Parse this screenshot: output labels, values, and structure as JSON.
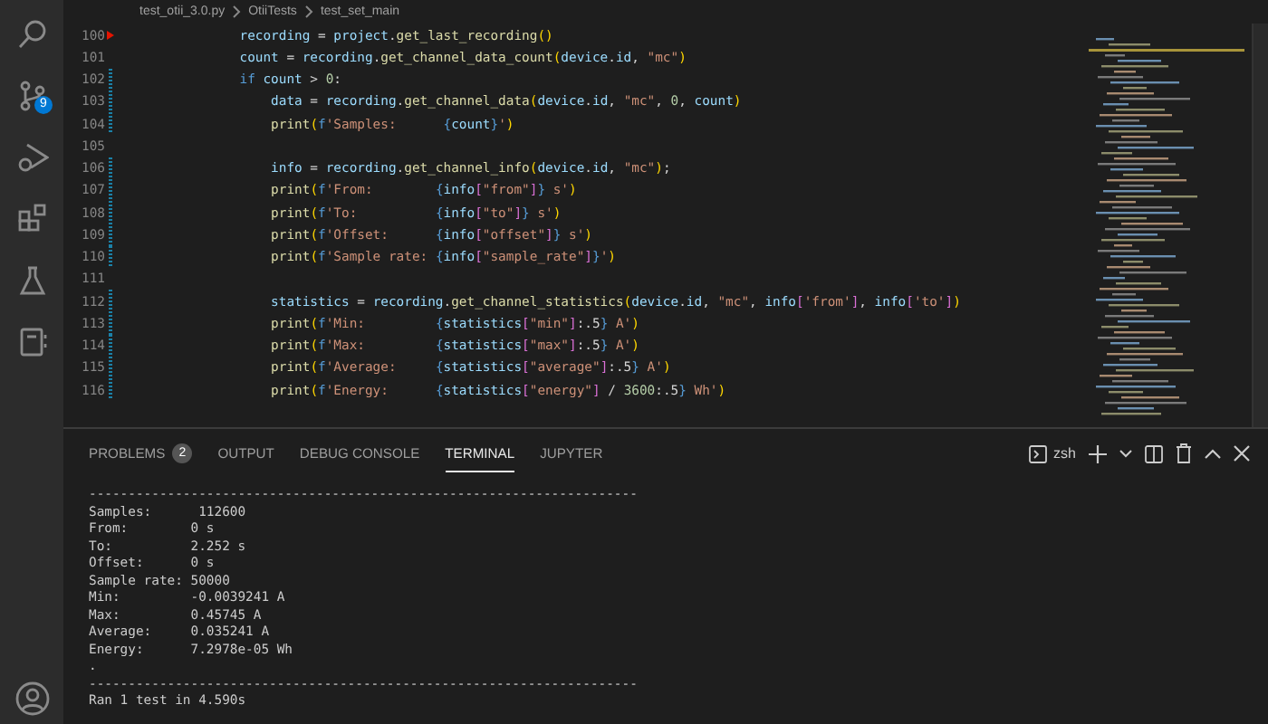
{
  "activity_bar": {
    "items": [
      {
        "kind": "search"
      },
      {
        "kind": "source-control",
        "badge": "9"
      },
      {
        "kind": "run"
      },
      {
        "kind": "extensions"
      },
      {
        "kind": "testing"
      },
      {
        "kind": "notebook"
      }
    ],
    "bottom": [
      {
        "kind": "account"
      }
    ]
  },
  "breadcrumb": [
    "test_otii_3.0.py",
    "OtiiTests",
    "test_set_main"
  ],
  "editor": {
    "lines": [
      {
        "number": "100",
        "breakpoint": true,
        "modified": false,
        "tokens": [
          {
            "kind": "var",
            "text": "                recording"
          },
          {
            "kind": "punc",
            "text": " = "
          },
          {
            "kind": "var",
            "text": "project"
          },
          {
            "kind": "punc",
            "text": "."
          },
          {
            "kind": "fn",
            "text": "get_last_recording"
          },
          {
            "kind": "brace",
            "text": "()"
          }
        ]
      },
      {
        "number": "101",
        "breakpoint": false,
        "modified": false,
        "tokens": [
          {
            "kind": "var",
            "text": "                count"
          },
          {
            "kind": "punc",
            "text": " = "
          },
          {
            "kind": "var",
            "text": "recording"
          },
          {
            "kind": "punc",
            "text": "."
          },
          {
            "kind": "fn",
            "text": "get_channel_data_count"
          },
          {
            "kind": "brace",
            "text": "("
          },
          {
            "kind": "var",
            "text": "device"
          },
          {
            "kind": "punc",
            "text": "."
          },
          {
            "kind": "var",
            "text": "id"
          },
          {
            "kind": "punc",
            "text": ", "
          },
          {
            "kind": "str",
            "text": "\"mc\""
          },
          {
            "kind": "brace",
            "text": ")"
          }
        ]
      },
      {
        "number": "102",
        "breakpoint": false,
        "modified": true,
        "tokens": [
          {
            "kind": "kw",
            "text": "                if"
          },
          {
            "kind": "var",
            "text": " count"
          },
          {
            "kind": "punc",
            "text": " > "
          },
          {
            "kind": "num",
            "text": "0"
          },
          {
            "kind": "punc",
            "text": ":"
          }
        ]
      },
      {
        "number": "103",
        "breakpoint": false,
        "modified": true,
        "tokens": [
          {
            "kind": "var",
            "text": "                    data"
          },
          {
            "kind": "punc",
            "text": " = "
          },
          {
            "kind": "var",
            "text": "recording"
          },
          {
            "kind": "punc",
            "text": "."
          },
          {
            "kind": "fn",
            "text": "get_channel_data"
          },
          {
            "kind": "brace",
            "text": "("
          },
          {
            "kind": "var",
            "text": "device"
          },
          {
            "kind": "punc",
            "text": "."
          },
          {
            "kind": "var",
            "text": "id"
          },
          {
            "kind": "punc",
            "text": ", "
          },
          {
            "kind": "str",
            "text": "\"mc\""
          },
          {
            "kind": "punc",
            "text": ", "
          },
          {
            "kind": "num",
            "text": "0"
          },
          {
            "kind": "punc",
            "text": ", "
          },
          {
            "kind": "var",
            "text": "count"
          },
          {
            "kind": "brace",
            "text": ")"
          }
        ]
      },
      {
        "number": "104",
        "breakpoint": false,
        "modified": true,
        "tokens": [
          {
            "kind": "fn",
            "text": "                    print"
          },
          {
            "kind": "brace",
            "text": "("
          },
          {
            "kind": "kw",
            "text": "f"
          },
          {
            "kind": "str",
            "text": "'Samples:      "
          },
          {
            "kind": "kw",
            "text": "{"
          },
          {
            "kind": "var",
            "text": "count"
          },
          {
            "kind": "kw",
            "text": "}"
          },
          {
            "kind": "str",
            "text": "'"
          },
          {
            "kind": "brace",
            "text": ")"
          }
        ]
      },
      {
        "number": "105",
        "breakpoint": false,
        "modified": false
      },
      {
        "number": "106",
        "breakpoint": false,
        "modified": true,
        "tokens": [
          {
            "kind": "var",
            "text": "                    info"
          },
          {
            "kind": "punc",
            "text": " = "
          },
          {
            "kind": "var",
            "text": "recording"
          },
          {
            "kind": "punc",
            "text": "."
          },
          {
            "kind": "fn",
            "text": "get_channel_info"
          },
          {
            "kind": "brace",
            "text": "("
          },
          {
            "kind": "var",
            "text": "device"
          },
          {
            "kind": "punc",
            "text": "."
          },
          {
            "kind": "var",
            "text": "id"
          },
          {
            "kind": "punc",
            "text": ", "
          },
          {
            "kind": "str",
            "text": "\"mc\""
          },
          {
            "kind": "brace",
            "text": ")"
          },
          {
            "kind": "punc",
            "text": ";"
          }
        ]
      },
      {
        "number": "107",
        "breakpoint": false,
        "modified": true,
        "tokens": [
          {
            "kind": "fn",
            "text": "                    print"
          },
          {
            "kind": "brace",
            "text": "("
          },
          {
            "kind": "kw",
            "text": "f"
          },
          {
            "kind": "str",
            "text": "'From:        "
          },
          {
            "kind": "kw",
            "text": "{"
          },
          {
            "kind": "var",
            "text": "info"
          },
          {
            "kind": "brace2",
            "text": "["
          },
          {
            "kind": "str",
            "text": "\"from\""
          },
          {
            "kind": "brace2",
            "text": "]"
          },
          {
            "kind": "kw",
            "text": "}"
          },
          {
            "kind": "str",
            "text": " s'"
          },
          {
            "kind": "brace",
            "text": ")"
          }
        ]
      },
      {
        "number": "108",
        "breakpoint": false,
        "modified": true,
        "tokens": [
          {
            "kind": "fn",
            "text": "                    print"
          },
          {
            "kind": "brace",
            "text": "("
          },
          {
            "kind": "kw",
            "text": "f"
          },
          {
            "kind": "str",
            "text": "'To:          "
          },
          {
            "kind": "kw",
            "text": "{"
          },
          {
            "kind": "var",
            "text": "info"
          },
          {
            "kind": "brace2",
            "text": "["
          },
          {
            "kind": "str",
            "text": "\"to\""
          },
          {
            "kind": "brace2",
            "text": "]"
          },
          {
            "kind": "kw",
            "text": "}"
          },
          {
            "kind": "str",
            "text": " s'"
          },
          {
            "kind": "brace",
            "text": ")"
          }
        ]
      },
      {
        "number": "109",
        "breakpoint": false,
        "modified": true,
        "tokens": [
          {
            "kind": "fn",
            "text": "                    print"
          },
          {
            "kind": "brace",
            "text": "("
          },
          {
            "kind": "kw",
            "text": "f"
          },
          {
            "kind": "str",
            "text": "'Offset:      "
          },
          {
            "kind": "kw",
            "text": "{"
          },
          {
            "kind": "var",
            "text": "info"
          },
          {
            "kind": "brace2",
            "text": "["
          },
          {
            "kind": "str",
            "text": "\"offset\""
          },
          {
            "kind": "brace2",
            "text": "]"
          },
          {
            "kind": "kw",
            "text": "}"
          },
          {
            "kind": "str",
            "text": " s'"
          },
          {
            "kind": "brace",
            "text": ")"
          }
        ]
      },
      {
        "number": "110",
        "breakpoint": false,
        "modified": true,
        "tokens": [
          {
            "kind": "fn",
            "text": "                    print"
          },
          {
            "kind": "brace",
            "text": "("
          },
          {
            "kind": "kw",
            "text": "f"
          },
          {
            "kind": "str",
            "text": "'Sample rate: "
          },
          {
            "kind": "kw",
            "text": "{"
          },
          {
            "kind": "var",
            "text": "info"
          },
          {
            "kind": "brace2",
            "text": "["
          },
          {
            "kind": "str",
            "text": "\"sample_rate\""
          },
          {
            "kind": "brace2",
            "text": "]"
          },
          {
            "kind": "kw",
            "text": "}"
          },
          {
            "kind": "str",
            "text": "'"
          },
          {
            "kind": "brace",
            "text": ")"
          }
        ]
      },
      {
        "number": "111",
        "breakpoint": false,
        "modified": false
      },
      {
        "number": "112",
        "breakpoint": false,
        "modified": true,
        "tokens": [
          {
            "kind": "var",
            "text": "                    statistics"
          },
          {
            "kind": "punc",
            "text": " = "
          },
          {
            "kind": "var",
            "text": "recording"
          },
          {
            "kind": "punc",
            "text": "."
          },
          {
            "kind": "fn",
            "text": "get_channel_statistics"
          },
          {
            "kind": "brace",
            "text": "("
          },
          {
            "kind": "var",
            "text": "device"
          },
          {
            "kind": "punc",
            "text": "."
          },
          {
            "kind": "var",
            "text": "id"
          },
          {
            "kind": "punc",
            "text": ", "
          },
          {
            "kind": "str",
            "text": "\"mc\""
          },
          {
            "kind": "punc",
            "text": ", "
          },
          {
            "kind": "var",
            "text": "info"
          },
          {
            "kind": "brace2",
            "text": "["
          },
          {
            "kind": "str",
            "text": "'from'"
          },
          {
            "kind": "brace2",
            "text": "]"
          },
          {
            "kind": "punc",
            "text": ", "
          },
          {
            "kind": "var",
            "text": "info"
          },
          {
            "kind": "brace2",
            "text": "["
          },
          {
            "kind": "str",
            "text": "'to'"
          },
          {
            "kind": "brace2",
            "text": "]"
          },
          {
            "kind": "brace",
            "text": ")"
          }
        ]
      },
      {
        "number": "113",
        "breakpoint": false,
        "modified": true,
        "tokens": [
          {
            "kind": "fn",
            "text": "                    print"
          },
          {
            "kind": "brace",
            "text": "("
          },
          {
            "kind": "kw",
            "text": "f"
          },
          {
            "kind": "str",
            "text": "'Min:         "
          },
          {
            "kind": "kw",
            "text": "{"
          },
          {
            "kind": "var",
            "text": "statistics"
          },
          {
            "kind": "brace2",
            "text": "["
          },
          {
            "kind": "str",
            "text": "\"min\""
          },
          {
            "kind": "brace2",
            "text": "]"
          },
          {
            "kind": "punc",
            "text": ":.5"
          },
          {
            "kind": "kw",
            "text": "}"
          },
          {
            "kind": "str",
            "text": " A'"
          },
          {
            "kind": "brace",
            "text": ")"
          }
        ]
      },
      {
        "number": "114",
        "breakpoint": false,
        "modified": true,
        "tokens": [
          {
            "kind": "fn",
            "text": "                    print"
          },
          {
            "kind": "brace",
            "text": "("
          },
          {
            "kind": "kw",
            "text": "f"
          },
          {
            "kind": "str",
            "text": "'Max:         "
          },
          {
            "kind": "kw",
            "text": "{"
          },
          {
            "kind": "var",
            "text": "statistics"
          },
          {
            "kind": "brace2",
            "text": "["
          },
          {
            "kind": "str",
            "text": "\"max\""
          },
          {
            "kind": "brace2",
            "text": "]"
          },
          {
            "kind": "punc",
            "text": ":.5"
          },
          {
            "kind": "kw",
            "text": "}"
          },
          {
            "kind": "str",
            "text": " A'"
          },
          {
            "kind": "brace",
            "text": ")"
          }
        ]
      },
      {
        "number": "115",
        "breakpoint": false,
        "modified": true,
        "tokens": [
          {
            "kind": "fn",
            "text": "                    print"
          },
          {
            "kind": "brace",
            "text": "("
          },
          {
            "kind": "kw",
            "text": "f"
          },
          {
            "kind": "str",
            "text": "'Average:     "
          },
          {
            "kind": "kw",
            "text": "{"
          },
          {
            "kind": "var",
            "text": "statistics"
          },
          {
            "kind": "brace2",
            "text": "["
          },
          {
            "kind": "str",
            "text": "\"average\""
          },
          {
            "kind": "brace2",
            "text": "]"
          },
          {
            "kind": "punc",
            "text": ":.5"
          },
          {
            "kind": "kw",
            "text": "}"
          },
          {
            "kind": "str",
            "text": " A'"
          },
          {
            "kind": "brace",
            "text": ")"
          }
        ]
      },
      {
        "number": "116",
        "breakpoint": false,
        "modified": true,
        "tokens": [
          {
            "kind": "fn",
            "text": "                    print"
          },
          {
            "kind": "brace",
            "text": "("
          },
          {
            "kind": "kw",
            "text": "f"
          },
          {
            "kind": "str",
            "text": "'Energy:      "
          },
          {
            "kind": "kw",
            "text": "{"
          },
          {
            "kind": "var",
            "text": "statistics"
          },
          {
            "kind": "brace2",
            "text": "["
          },
          {
            "kind": "str",
            "text": "\"energy\""
          },
          {
            "kind": "brace2",
            "text": "]"
          },
          {
            "kind": "punc",
            "text": " / "
          },
          {
            "kind": "num",
            "text": "3600"
          },
          {
            "kind": "punc",
            "text": ":.5"
          },
          {
            "kind": "kw",
            "text": "}"
          },
          {
            "kind": "str",
            "text": " Wh'"
          },
          {
            "kind": "brace",
            "text": ")"
          }
        ]
      }
    ]
  },
  "panel": {
    "tabs": [
      {
        "label": "PROBLEMS",
        "badge": "2",
        "selected": false
      },
      {
        "label": "OUTPUT",
        "selected": false
      },
      {
        "label": "DEBUG CONSOLE",
        "selected": false
      },
      {
        "label": "TERMINAL",
        "selected": true
      },
      {
        "label": "JUPYTER",
        "selected": false
      }
    ],
    "terminal_name": "zsh",
    "terminal_lines": [
      "----------------------------------------------------------------------",
      "Samples:      112600",
      "From:        0 s",
      "To:          2.252 s",
      "Offset:      0 s",
      "Sample rate: 50000",
      "Min:         -0.0039241 A",
      "Max:         0.45745 A",
      "Average:     0.035241 A",
      "Energy:      7.2978e-05 Wh",
      ".",
      "----------------------------------------------------------------------",
      "Ran 1 test in 4.590s"
    ]
  }
}
